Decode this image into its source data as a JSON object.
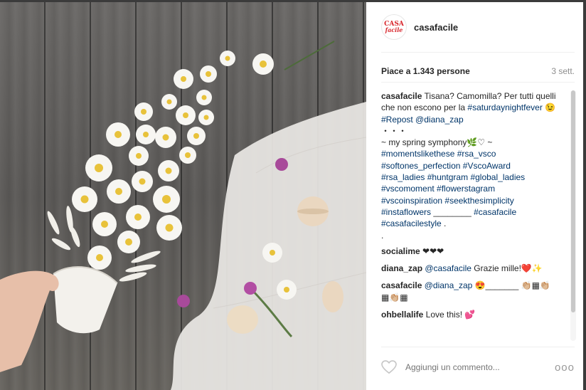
{
  "post": {
    "username": "casafacile",
    "avatar_text_1": "CASA",
    "avatar_text_2": "facile",
    "likes": "Piace a 1.343 persone",
    "time": "3 sett."
  },
  "caption": {
    "user": "casafacile",
    "parts": [
      {
        "t": "Tisana? Camomilla? Per tutti quelli che non escono per la ",
        "k": "text"
      },
      {
        "t": "#saturdaynightfever",
        "k": "tag"
      },
      {
        "t": " 😉",
        "k": "text"
      },
      {
        "t": "#Repost",
        "k": "tag"
      },
      {
        "t": " ",
        "k": "text"
      },
      {
        "t": "@diana_zap",
        "k": "tag"
      },
      {
        "t": "\n・・・\n~ my spring symphony🌿♡ ~\n",
        "k": "text"
      },
      {
        "t": "#momentslikethese",
        "k": "tag"
      },
      {
        "t": " ",
        "k": "text"
      },
      {
        "t": "#rsa_vsco",
        "k": "tag"
      },
      {
        "t": "\n",
        "k": "text"
      },
      {
        "t": "#softones_perfection",
        "k": "tag"
      },
      {
        "t": " ",
        "k": "text"
      },
      {
        "t": "#VscoAward",
        "k": "tag"
      },
      {
        "t": "\n",
        "k": "text"
      },
      {
        "t": "#rsa_ladies",
        "k": "tag"
      },
      {
        "t": " ",
        "k": "text"
      },
      {
        "t": "#huntgram",
        "k": "tag"
      },
      {
        "t": " ",
        "k": "text"
      },
      {
        "t": "#global_ladies",
        "k": "tag"
      },
      {
        "t": "\n",
        "k": "text"
      },
      {
        "t": "#vscomoment",
        "k": "tag"
      },
      {
        "t": " ",
        "k": "text"
      },
      {
        "t": "#flowerstagram",
        "k": "tag"
      },
      {
        "t": "\n",
        "k": "text"
      },
      {
        "t": "#vscoinspiration",
        "k": "tag"
      },
      {
        "t": " ",
        "k": "text"
      },
      {
        "t": "#seekthesimplicity",
        "k": "tag"
      },
      {
        "t": "\n",
        "k": "text"
      },
      {
        "t": "#instaflowers",
        "k": "tag"
      },
      {
        "t": " ________ ",
        "k": "text"
      },
      {
        "t": "#casafacile",
        "k": "tag"
      },
      {
        "t": "\n",
        "k": "text"
      },
      {
        "t": "#casafacilestyle",
        "k": "tag"
      },
      {
        "t": " .\n.",
        "k": "text"
      }
    ]
  },
  "comments": [
    {
      "user": "socialime",
      "parts": [
        {
          "t": " ❤❤❤",
          "k": "text"
        }
      ],
      "remove": "×"
    },
    {
      "user": "diana_zap",
      "parts": [
        {
          "t": " ",
          "k": "text"
        },
        {
          "t": "@casafacile",
          "k": "tag"
        },
        {
          "t": " Grazie mille!❤️✨",
          "k": "text"
        }
      ],
      "remove": "×"
    },
    {
      "user": "casafacile",
      "parts": [
        {
          "t": " ",
          "k": "text"
        },
        {
          "t": "@diana_zap",
          "k": "tag"
        },
        {
          "t": " 😍_______ 👏🏼▦👏🏼▦👏🏼▦",
          "k": "text"
        }
      ],
      "remove": "×"
    },
    {
      "user": "ohbellalife",
      "parts": [
        {
          "t": " Love this! 💕",
          "k": "text"
        }
      ],
      "remove": "×"
    }
  ],
  "footer": {
    "like_icon": "heart-outline-icon",
    "comment_placeholder": "Aggiungi un commento...",
    "more_label": "ooo"
  },
  "colors": {
    "hashtag": "#003569",
    "username": "#262626",
    "meta": "#8e8e8e",
    "brand_red": "#d8262c"
  }
}
